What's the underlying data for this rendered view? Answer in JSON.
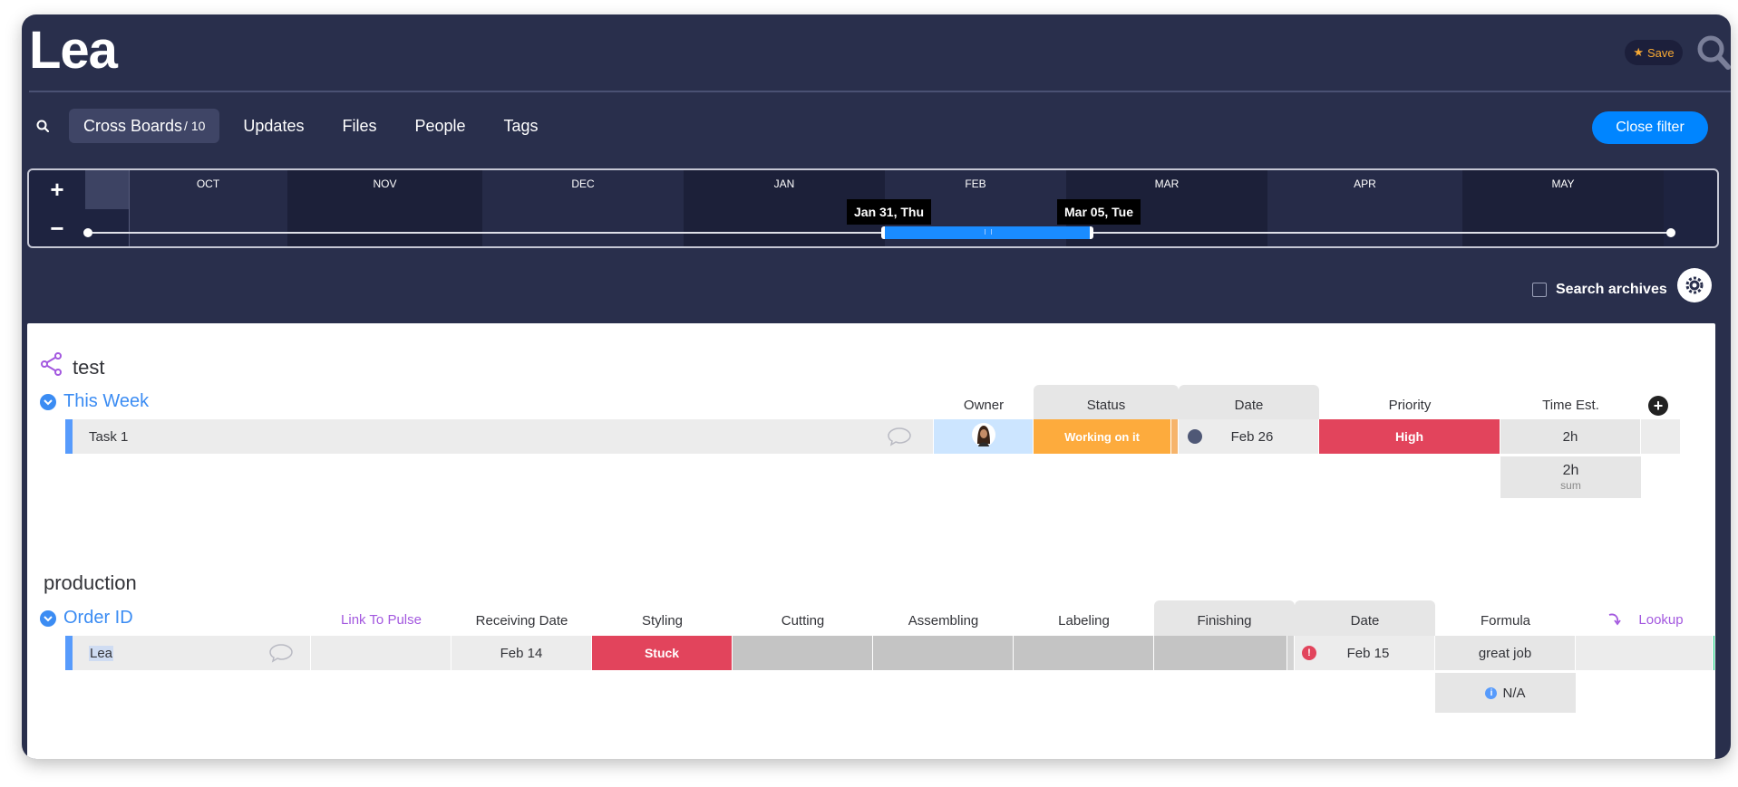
{
  "header": {
    "title": "Lea",
    "save_label": "Save",
    "accent": "#f7a934"
  },
  "nav": {
    "tabs": [
      {
        "label": "Cross Boards",
        "count": "/ 10"
      },
      {
        "label": "Updates"
      },
      {
        "label": "Files"
      },
      {
        "label": "People"
      },
      {
        "label": "Tags"
      }
    ],
    "close_filter_label": "Close filter"
  },
  "timeline": {
    "months": [
      "OCT",
      "NOV",
      "DEC",
      "JAN",
      "FEB",
      "MAR",
      "APR",
      "MAY"
    ],
    "range_start": "Jan 31, Thu",
    "range_end": "Mar 05, Tue",
    "zoom_in": "+",
    "zoom_out": "−"
  },
  "options": {
    "search_archives_label": "Search archives"
  },
  "board1": {
    "name": "test",
    "group": "This Week",
    "columns": [
      "Owner",
      "Status",
      "Date",
      "Priority",
      "Time Est."
    ],
    "row": {
      "name": "Task 1",
      "status": "Working on it",
      "date": "Feb 26",
      "priority": "High",
      "time": "2h"
    },
    "sum_value": "2h",
    "sum_label": "sum"
  },
  "board2": {
    "name": "production",
    "group": "Order ID",
    "columns": [
      "Link To Pulse",
      "Receiving Date",
      "Styling",
      "Cutting",
      "Assembling",
      "Labeling",
      "Finishing",
      "Date",
      "Formula",
      "Lookup"
    ],
    "row": {
      "name": "Lea",
      "receiving_date": "Feb 14",
      "styling": "Stuck",
      "date": "Feb 15",
      "formula": "great job"
    },
    "formula_summary": "N/A"
  },
  "colors": {
    "status_orange": "#fdab3d",
    "priority_red": "#e2445c",
    "stuck_red": "#e2445c",
    "group_blue": "#3b8cf3",
    "button_blue": "#0085ff"
  }
}
